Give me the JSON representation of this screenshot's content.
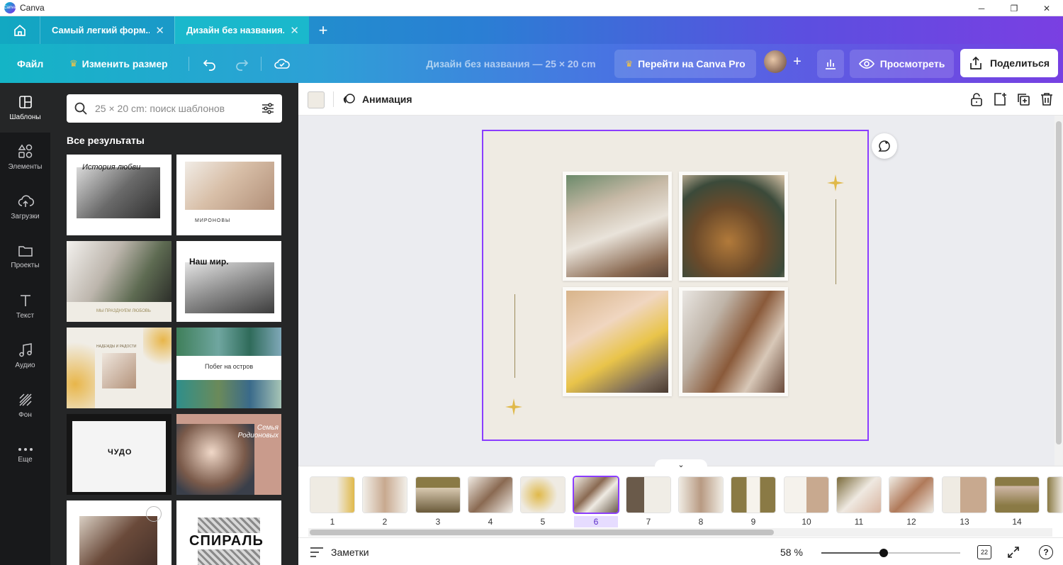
{
  "window": {
    "title": "Canva",
    "logo_text": "Canva",
    "controls": [
      "─",
      "❐",
      "✕"
    ]
  },
  "tabs": [
    {
      "label": "Самый легкий форм...",
      "active": false
    },
    {
      "label": "Дизайн без названия...",
      "active": true
    }
  ],
  "toolbar": {
    "file_label": "Файл",
    "resize_label": "Изменить размер",
    "design_title": "Дизайн без названия — 25 × 20 cm",
    "pro_label": "Перейти на Canva Pro",
    "plus_label": "+",
    "view_label": "Просмотреть",
    "share_label": "Поделиться"
  },
  "rail": [
    {
      "key": "templates",
      "label": "Шаблоны",
      "icon": "templates-icon",
      "active": true
    },
    {
      "key": "elements",
      "label": "Элементы",
      "icon": "elements-icon",
      "active": false
    },
    {
      "key": "uploads",
      "label": "Загрузки",
      "icon": "upload-cloud-icon",
      "active": false
    },
    {
      "key": "projects",
      "label": "Проекты",
      "icon": "folder-icon",
      "active": false
    },
    {
      "key": "text",
      "label": "Текст",
      "icon": "text-icon",
      "active": false
    },
    {
      "key": "audio",
      "label": "Аудио",
      "icon": "music-note-icon",
      "active": false
    },
    {
      "key": "background",
      "label": "Фон",
      "icon": "background-pattern-icon",
      "active": false
    },
    {
      "key": "more",
      "label": "Еще",
      "icon": "more-dots-icon",
      "active": false
    }
  ],
  "panel": {
    "search_placeholder": "25 × 20 cm: поиск шаблонов",
    "section_title": "Все результаты",
    "templates": [
      {
        "caption": "История любви"
      },
      {
        "caption": "МИРОНОВЫ"
      },
      {
        "caption": "МЫ ПРАЗДНУЕМ ЛЮБОВЬ"
      },
      {
        "caption": "Наш мир."
      },
      {
        "caption": "НАДЕЖДЫ И РАДОСТИ"
      },
      {
        "caption": "Побег на остров"
      },
      {
        "caption": "ЧУДО"
      },
      {
        "caption": "Семья Родионовых"
      },
      {
        "caption": ""
      },
      {
        "caption": "СПИРАЛЬ"
      }
    ]
  },
  "editor": {
    "animation_label": "Анимация",
    "page_bg": "#efebe3",
    "accent": "#8b3dff"
  },
  "pages": [
    "1",
    "2",
    "3",
    "4",
    "5",
    "6",
    "7",
    "8",
    "9",
    "10",
    "11",
    "12",
    "13",
    "14"
  ],
  "selected_page": "6",
  "bottom": {
    "notes_label": "Заметки",
    "zoom_label": "58 %",
    "zoom_fraction": 0.45,
    "page_count_badge": "22",
    "help_label": "?"
  }
}
